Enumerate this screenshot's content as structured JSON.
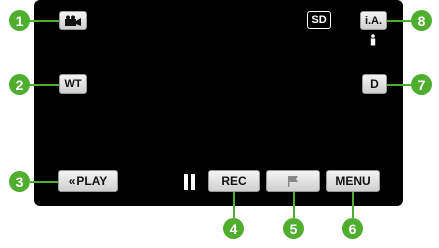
{
  "screen": {
    "top_right": {
      "sd_label": "SD",
      "ia_label": "i.A."
    },
    "left": {
      "wt_label": "WT",
      "play_label": "PLAY"
    },
    "right": {
      "d_label": "D"
    },
    "bottom": {
      "rec_label": "REC",
      "menu_label": "MENU"
    }
  },
  "callouts": [
    "1",
    "2",
    "3",
    "4",
    "5",
    "6",
    "7",
    "8"
  ],
  "colors": {
    "callout": "#4fae2e",
    "screen": "#000000",
    "button": "#e6e6e6"
  }
}
